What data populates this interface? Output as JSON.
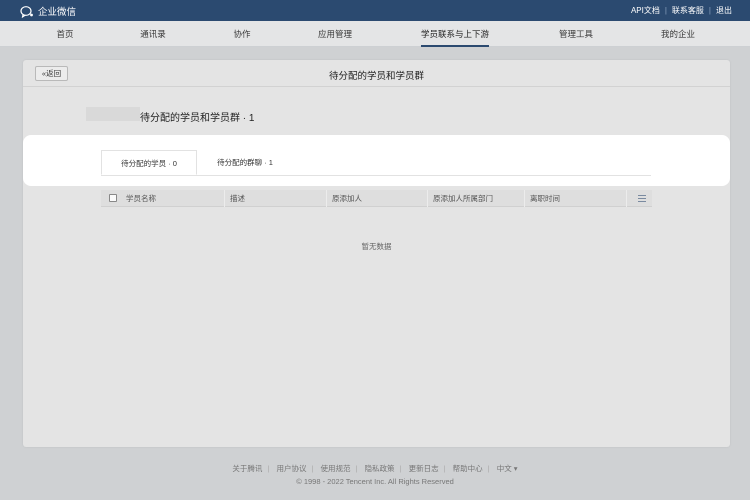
{
  "topbar": {
    "logo_text": "企业微信",
    "links": [
      "API文档",
      "联系客服",
      "退出"
    ]
  },
  "nav": {
    "items": [
      "首页",
      "通讯录",
      "协作",
      "应用管理",
      "学员联系与上下游",
      "管理工具",
      "我的企业"
    ],
    "active_index": 4
  },
  "card": {
    "back_label": "返回",
    "title": "待分配的学员和学员群",
    "section_title": "待分配的学员和学员群 · 1"
  },
  "tabs": [
    {
      "label": "待分配的学员 · 0",
      "active": true
    },
    {
      "label": "待分配的群聊 · 1",
      "active": false
    }
  ],
  "table": {
    "columns": [
      "学员名称",
      "描述",
      "原添加人",
      "原添加人所属部门",
      "离职时间"
    ],
    "rows": [],
    "empty_text": "暂无数据"
  },
  "footer": {
    "links": [
      "关于腾讯",
      "用户协议",
      "使用规范",
      "隐私政策",
      "更新日志",
      "帮助中心",
      "中文 ▾"
    ],
    "copyright": "© 1998 - 2022 Tencent Inc. All Rights Reserved"
  },
  "colors": {
    "topbar": "#2b4a70",
    "nav_bg": "#e4e5e6",
    "page_bg": "#cfd1d3"
  }
}
